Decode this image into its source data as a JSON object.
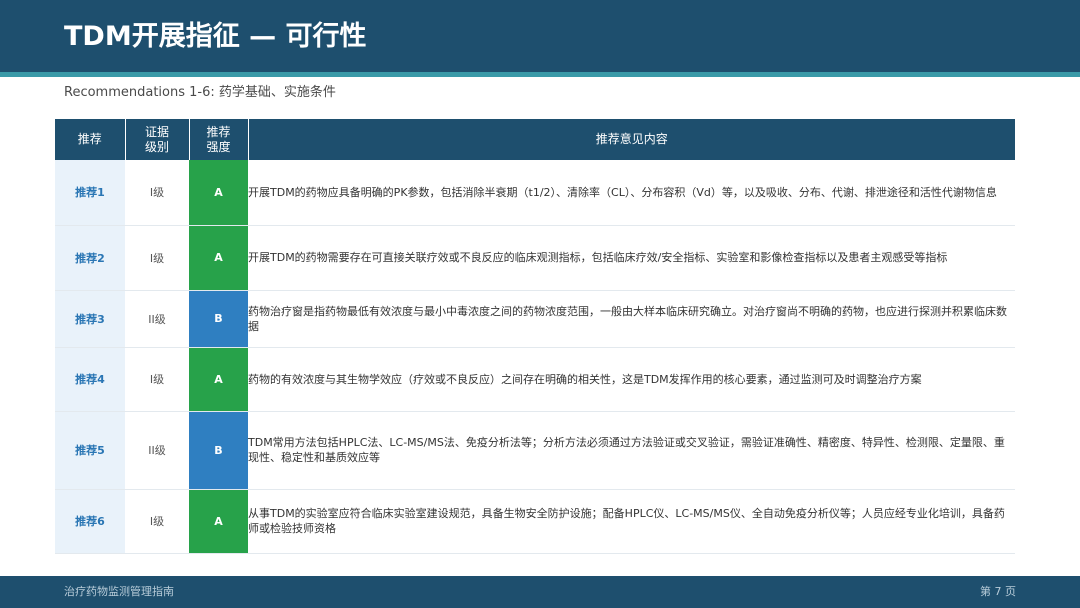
{
  "header": {
    "title": "TDM开展指征 — 可行性"
  },
  "subtitle": "Recommendations 1-6: 药学基础、实施条件",
  "table": {
    "columns": {
      "rec": "推荐",
      "level_line1": "证据",
      "level_line2": "级别",
      "strength_line1": "推荐",
      "strength_line2": "强度",
      "content": "推荐意见内容"
    },
    "rows": [
      {
        "rec": "推荐1",
        "level": "I级",
        "strength": "A",
        "strength_color": "#27a24a",
        "content": "开展TDM的药物应具备明确的PK参数，包括消除半衰期（t1/2）、清除率（CL）、分布容积（Vd）等，以及吸收、分布、代谢、排泄途径和活性代谢物信息"
      },
      {
        "rec": "推荐2",
        "level": "I级",
        "strength": "A",
        "strength_color": "#27a24a",
        "content": "开展TDM的药物需要存在可直接关联疗效或不良反应的临床观测指标，包括临床疗效/安全指标、实验室和影像检查指标以及患者主观感受等指标"
      },
      {
        "rec": "推荐3",
        "level": "II级",
        "strength": "B",
        "strength_color": "#2f7fc1",
        "content": "药物治疗窗是指药物最低有效浓度与最小中毒浓度之间的药物浓度范围，一般由大样本临床研究确立。对治疗窗尚不明确的药物，也应进行探测并积累临床数据"
      },
      {
        "rec": "推荐4",
        "level": "I级",
        "strength": "A",
        "strength_color": "#27a24a",
        "content": "药物的有效浓度与其生物学效应（疗效或不良反应）之间存在明确的相关性，这是TDM发挥作用的核心要素，通过监测可及时调整治疗方案"
      },
      {
        "rec": "推荐5",
        "level": "II级",
        "strength": "B",
        "strength_color": "#2f7fc1",
        "content": "TDM常用方法包括HPLC法、LC-MS/MS法、免疫分析法等；分析方法必须通过方法验证或交叉验证，需验证准确性、精密度、特异性、检测限、定量限、重现性、稳定性和基质效应等"
      },
      {
        "rec": "推荐6",
        "level": "I级",
        "strength": "A",
        "strength_color": "#27a24a",
        "content": "从事TDM的实验室应符合临床实验室建设规范，具备生物安全防护设施；配备HPLC仪、LC-MS/MS仪、全自动免疫分析仪等；人员应经专业化培训，具备药师或检验技师资格"
      }
    ]
  },
  "footer": {
    "left": "治疗药物监测管理指南",
    "right": "第 7 页"
  },
  "colors": {
    "brand": "#1e4f6e",
    "accent": "#3a9aa8",
    "strength_a": "#27a24a",
    "strength_b": "#2f7fc1"
  }
}
